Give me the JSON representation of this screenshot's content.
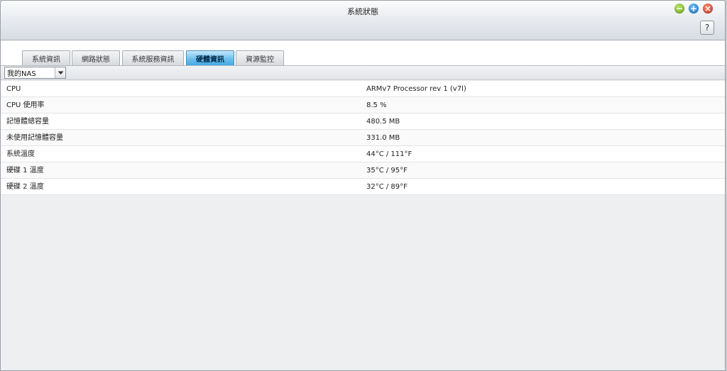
{
  "window": {
    "title": "系統狀態"
  },
  "controls": {
    "help_label": "?"
  },
  "tabs": [
    {
      "label": "系統資訊",
      "active": false
    },
    {
      "label": "網路狀態",
      "active": false
    },
    {
      "label": "系統服務資訊",
      "active": false
    },
    {
      "label": "硬體資訊",
      "active": true
    },
    {
      "label": "資源監控",
      "active": false
    }
  ],
  "device_select": {
    "value": "我的NAS"
  },
  "hardware_info": [
    {
      "key": "CPU",
      "value": "ARMv7 Processor rev 1 (v7l)"
    },
    {
      "key": "CPU 使用率",
      "value": "8.5 %"
    },
    {
      "key": "記憶體總容量",
      "value": "480.5 MB"
    },
    {
      "key": "未使用記憶體容量",
      "value": "331.0 MB"
    },
    {
      "key": "系統溫度",
      "value": "44°C / 111°F"
    },
    {
      "key": "硬碟 1 溫度",
      "value": "35°C / 95°F"
    },
    {
      "key": "硬碟 2 溫度",
      "value": "32°C / 89°F"
    }
  ],
  "icons": {
    "minimize": "minimize-icon",
    "maximize": "maximize-icon",
    "close": "close-icon",
    "dropdown": "chevron-down-icon"
  },
  "colors": {
    "active_tab": "#3ea6e2",
    "minimize": "#6ca31b",
    "maximize": "#1a72c2",
    "close": "#c8301b"
  }
}
